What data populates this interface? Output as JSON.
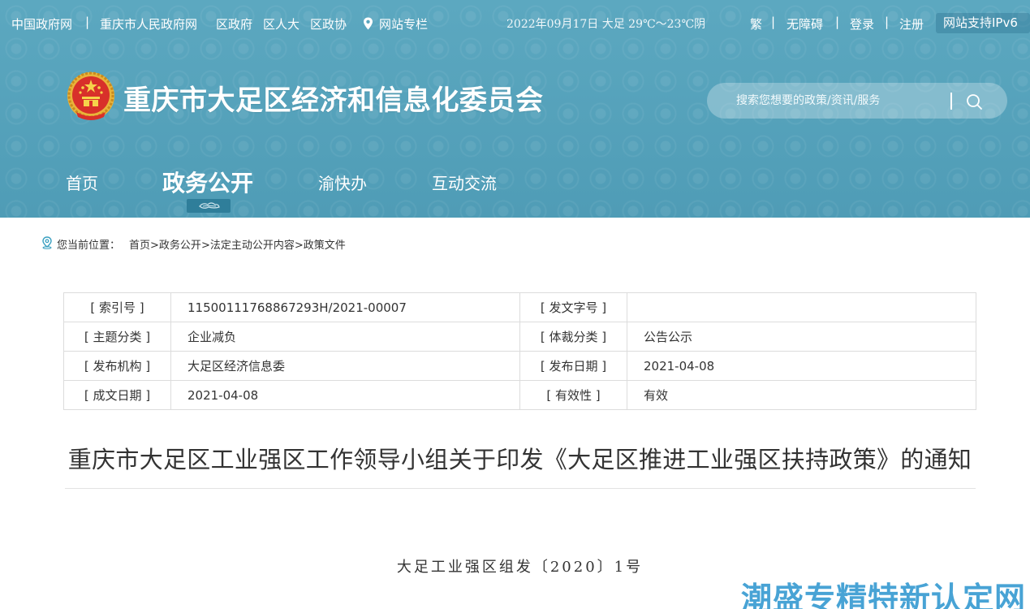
{
  "topbar": {
    "links": [
      "中国政府网",
      "重庆市人民政府网",
      "区政府",
      "区人大",
      "区政协"
    ],
    "special_column": "网站专栏",
    "date_weather": "2022年09月17日 大足 29℃～23℃阴",
    "utils": [
      "繁",
      "无障碍",
      "登录",
      "注册"
    ],
    "ipv6": "网站支持IPv6"
  },
  "header": {
    "site_title": "重庆市大足区经济和信息化委员会",
    "search_placeholder": "搜索您想要的政策/资讯/服务"
  },
  "nav": {
    "items": [
      "首页",
      "政务公开",
      "渝快办",
      "互动交流"
    ],
    "active": "政务公开"
  },
  "breadcrumb": {
    "label": "您当前位置：",
    "items": [
      "首页",
      "政务公开",
      "法定主动公开内容",
      "政策文件"
    ]
  },
  "info": {
    "index_no_label": "[ 索引号 ]",
    "index_no": "11500111768867293H/2021-00007",
    "doc_no_label": "[ 发文字号 ]",
    "doc_no": "",
    "topic_label": "[ 主题分类 ]",
    "topic": "企业减负",
    "genre_label": "[ 体裁分类 ]",
    "genre": "公告公示",
    "publisher_label": "[ 发布机构 ]",
    "publisher": "大足区经济信息委",
    "publish_date_label": "[ 发布日期 ]",
    "publish_date": "2021-04-08",
    "written_date_label": "[ 成文日期 ]",
    "written_date": "2021-04-08",
    "validity_label": "[ 有效性 ]",
    "validity": "有效"
  },
  "article": {
    "title": "重庆市大足区工业强区工作领导小组关于印发《大足区推进工业强区扶持政策》的通知",
    "doc_number": "大足工业强区组发〔2020〕1号"
  },
  "watermark": "潮盛专精特新认定网",
  "colors": {
    "header_bg": "#5aa5bd",
    "nav_indicator": "#2f7e9a",
    "watermark": "#3f9fd3",
    "breadcrumb_icon": "#3aa0c0"
  }
}
